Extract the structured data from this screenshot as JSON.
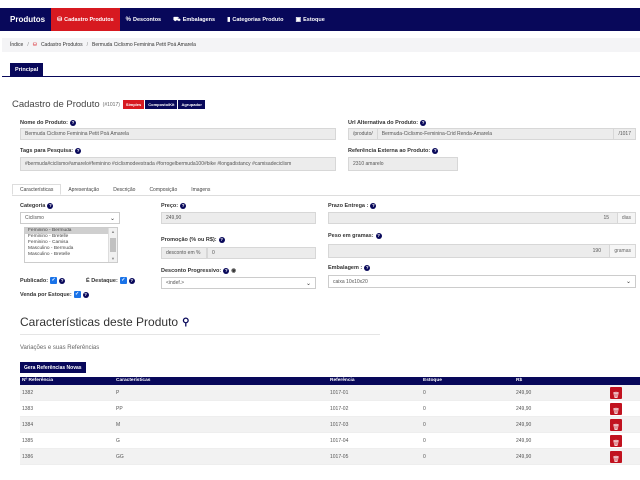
{
  "nav": {
    "brand": "Produtos",
    "items": [
      {
        "label": "Cadastro Produtos",
        "icon": "shopping-basket-icon",
        "glyph": "⛁",
        "active": true
      },
      {
        "label": "Descontos",
        "icon": "percent-icon",
        "glyph": "%",
        "active": false
      },
      {
        "label": "Embalagens",
        "icon": "truck-icon",
        "glyph": "⛟",
        "active": false
      },
      {
        "label": "Categorias Produto",
        "icon": "bar-chart-icon",
        "glyph": "▮",
        "active": false
      },
      {
        "label": "Estoque",
        "icon": "box-icon",
        "glyph": "▣",
        "active": false
      }
    ]
  },
  "breadcrumb": {
    "home": "Índice",
    "section": "Cadastro Produtos",
    "current": "Bermuda Ciclismo Feminina Petit Poá Amarela"
  },
  "main_tab": "Principal",
  "title": {
    "text": "Cadastro de Produto",
    "code": "(#1017)",
    "types": [
      "Simples",
      "Composto/Kit",
      "Agrupador"
    ]
  },
  "fields": {
    "nome_label": "Nome do Produto:",
    "nome_value": "Bermuda Ciclismo Feminina Petit Poá Amarela",
    "url_label": "Url Alternativa do Produto:",
    "url_prefix": "/produto/",
    "url_slug": "Bermuda-Ciclismo-Feminina-Crid Renda-Amarela",
    "url_suffix": "/1017",
    "tags_label": "Tags para Pesquisa:",
    "tags_value": "#bermuda#ciclismo#amarelo#feminino #ciclismodeestrada #forrogelbermuda100#bike #longadistancy #camisadeciclism",
    "ref_label": "Referência Externa ao Produto:",
    "ref_value": "2310 amarelo"
  },
  "subtabs": [
    "Características",
    "Apresentação",
    "Descrição",
    "Composição",
    "Imagens"
  ],
  "caracteristicas": {
    "categoria_label": "Categoria",
    "categoria_value": "Ciclismo",
    "listbox_options": [
      "Feminino - Bermuda",
      "Feminino - Bretelle",
      "Feminino - Camisa",
      "Masculino - Bermuda",
      "Masculino - Bretelle"
    ],
    "publicado_label": "Publicado:",
    "destaque_label": "É Destaque:",
    "venda_estoque_label": "Venda por Estoque:",
    "preco_label": "Preço:",
    "preco_value": "249,90",
    "promocao_label": "Promoção (% ou R$):",
    "promocao_type": "desconto em %",
    "promocao_value": "0",
    "desconto_label": "Desconto Progressivo:",
    "desconto_value": "<indef.>",
    "prazo_label": "Prazo Entrega :",
    "prazo_value": "15",
    "prazo_unit": "dias",
    "peso_label": "Peso em gramas:",
    "peso_value": "190",
    "peso_unit": "gramas",
    "embalagem_label": "Embalagem :",
    "embalagem_value": "caixa 10x10x20"
  },
  "variations": {
    "title": "Características deste Produto",
    "subtitle": "Variações e suas Referências",
    "button": "Gera Referências Novas",
    "headers": [
      "Nº Referência",
      "Características",
      "Referência",
      "Estoque",
      "R$"
    ],
    "rows": [
      {
        "id": "1382",
        "caract": "P",
        "ref": "1017-01",
        "estoque": "0",
        "preco": "249,90"
      },
      {
        "id": "1383",
        "caract": "PP",
        "ref": "1017-02",
        "estoque": "0",
        "preco": "249,90"
      },
      {
        "id": "1384",
        "caract": "M",
        "ref": "1017-03",
        "estoque": "0",
        "preco": "249,90"
      },
      {
        "id": "1385",
        "caract": "G",
        "ref": "1017-04",
        "estoque": "0",
        "preco": "249,90"
      },
      {
        "id": "1386",
        "caract": "GG",
        "ref": "1017-05",
        "estoque": "0",
        "preco": "249,90"
      }
    ]
  },
  "colors": {
    "navy": "#08085a",
    "red": "#d71920",
    "check": "#1a73e8"
  }
}
